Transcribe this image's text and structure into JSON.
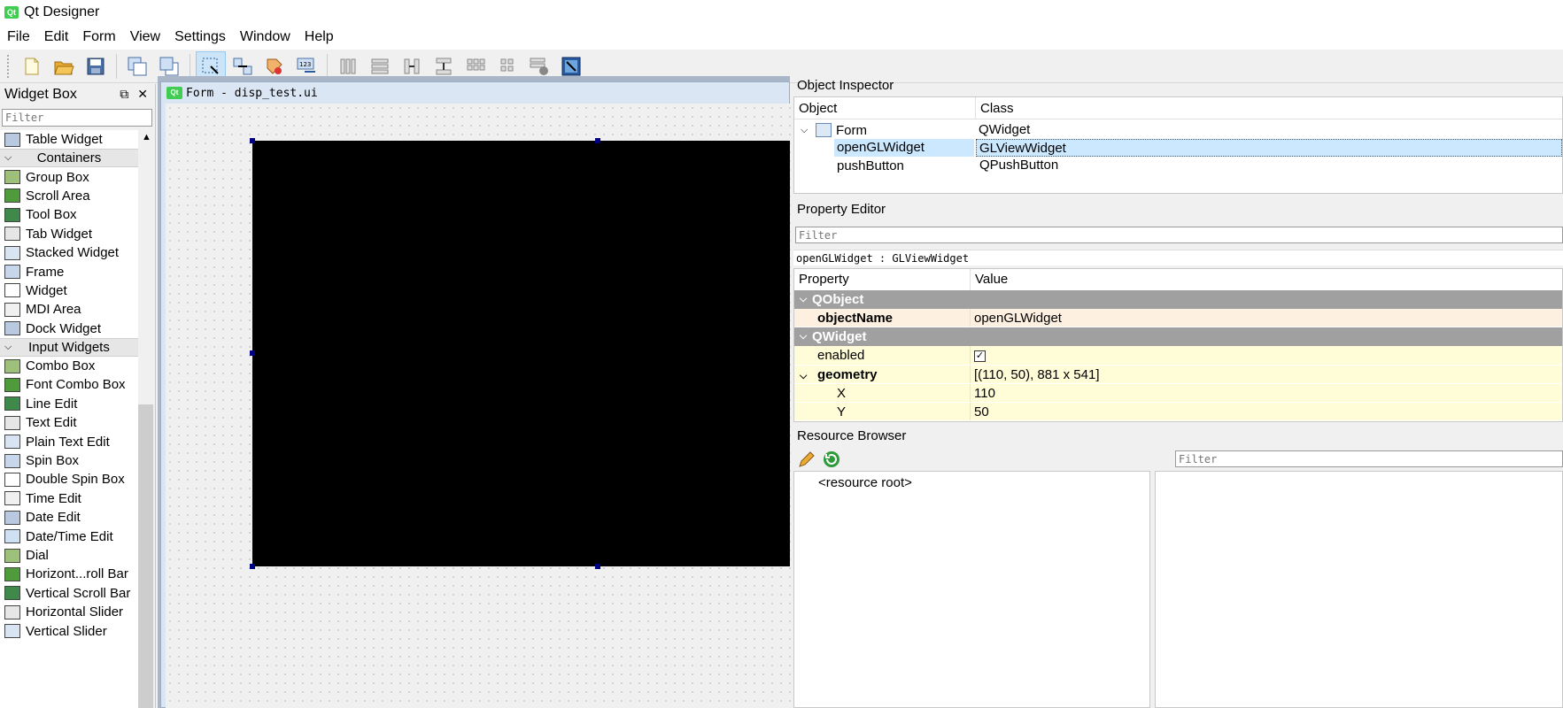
{
  "window": {
    "title": "Qt Designer",
    "logo_text": "Qt"
  },
  "menu": [
    "File",
    "Edit",
    "Form",
    "View",
    "Settings",
    "Window",
    "Help"
  ],
  "toolbar": {
    "buttons": [
      "new-form",
      "open-form",
      "save-form",
      "send-to-back",
      "bring-to-front",
      "edit-widgets",
      "edit-signals-slots",
      "edit-buddies",
      "edit-tab-order",
      "lay-out-horizontally",
      "lay-out-vertically",
      "lay-out-horizontally-splitter",
      "lay-out-vertically-splitter",
      "lay-out-grid",
      "lay-out-form",
      "break-layout",
      "adjust-size"
    ]
  },
  "widget_box": {
    "title": "Widget Box",
    "filter_placeholder": "Filter",
    "items": [
      {
        "type": "item",
        "label": "Table Widget"
      },
      {
        "type": "category",
        "label": "Containers"
      },
      {
        "type": "item",
        "label": "Group Box"
      },
      {
        "type": "item",
        "label": "Scroll Area"
      },
      {
        "type": "item",
        "label": "Tool Box"
      },
      {
        "type": "item",
        "label": "Tab Widget"
      },
      {
        "type": "item",
        "label": "Stacked Widget"
      },
      {
        "type": "item",
        "label": "Frame"
      },
      {
        "type": "item",
        "label": "Widget"
      },
      {
        "type": "item",
        "label": "MDI Area"
      },
      {
        "type": "item",
        "label": "Dock Widget"
      },
      {
        "type": "category",
        "label": "Input Widgets"
      },
      {
        "type": "item",
        "label": "Combo Box"
      },
      {
        "type": "item",
        "label": "Font Combo Box"
      },
      {
        "type": "item",
        "label": "Line Edit"
      },
      {
        "type": "item",
        "label": "Text Edit"
      },
      {
        "type": "item",
        "label": "Plain Text Edit"
      },
      {
        "type": "item",
        "label": "Spin Box"
      },
      {
        "type": "item",
        "label": "Double Spin Box"
      },
      {
        "type": "item",
        "label": "Time Edit"
      },
      {
        "type": "item",
        "label": "Date Edit"
      },
      {
        "type": "item",
        "label": "Date/Time Edit"
      },
      {
        "type": "item",
        "label": "Dial"
      },
      {
        "type": "item",
        "label": "Horizont...roll Bar"
      },
      {
        "type": "item",
        "label": "Vertical Scroll Bar"
      },
      {
        "type": "item",
        "label": "Horizontal Slider"
      },
      {
        "type": "item",
        "label": "Vertical Slider"
      }
    ]
  },
  "form": {
    "title": "Form - disp_test.ui",
    "logo_text": "Qt"
  },
  "object_inspector": {
    "title": "Object Inspector",
    "col_object": "Object",
    "col_class": "Class",
    "rows": [
      {
        "name": "Form",
        "class": "QWidget"
      },
      {
        "name": "openGLWidget",
        "class": "GLViewWidget"
      },
      {
        "name": "pushButton",
        "class": "QPushButton"
      }
    ]
  },
  "property_editor": {
    "title": "Property Editor",
    "filter_placeholder": "Filter",
    "object_class": "openGLWidget : GLViewWidget",
    "col_property": "Property",
    "col_value": "Value",
    "cat_qobject": "QObject",
    "cat_qwidget": "QWidget",
    "objectName_key": "objectName",
    "objectName_val": "openGLWidget",
    "enabled_key": "enabled",
    "enabled_checked": true,
    "geometry_key": "geometry",
    "geometry_val": "[(110, 50), 881 x 541]",
    "x_key": "X",
    "x_val": "110",
    "y_key": "Y",
    "y_val": "50"
  },
  "resource_browser": {
    "title": "Resource Browser",
    "filter_placeholder": "Filter",
    "root": "<resource root>"
  },
  "colors": {
    "selection": "#cce8ff",
    "category_bg": "#a0a0a0",
    "qobject_row": "#fdf0e0",
    "qwidget_row": "#fffdd8",
    "mdi_bg": "#a9b6c7"
  }
}
